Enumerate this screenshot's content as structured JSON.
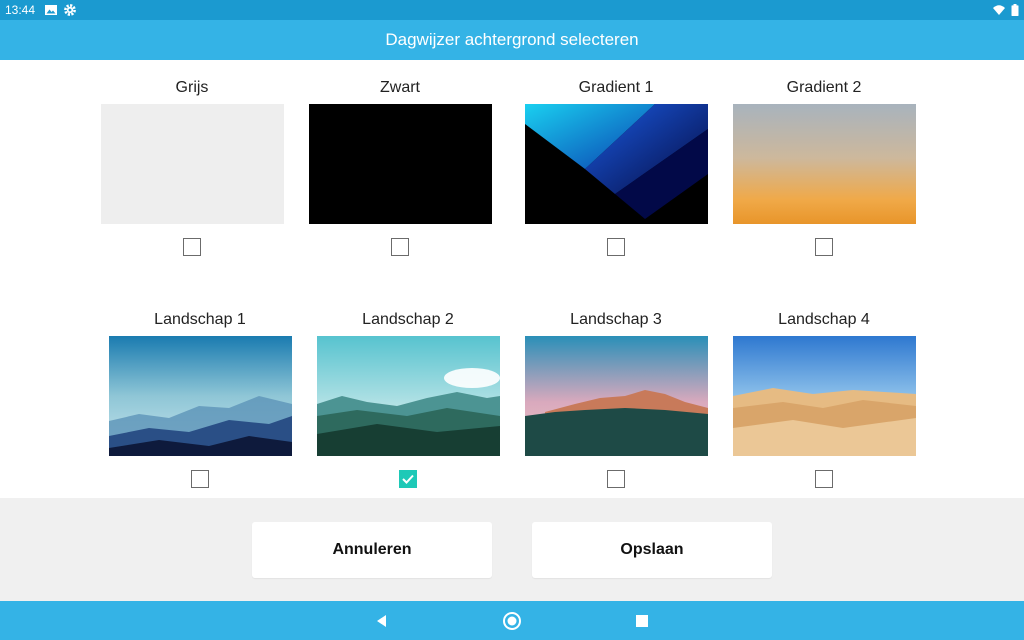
{
  "status_bar": {
    "time": "13:44",
    "left_icons": [
      "image-icon",
      "gear-icon"
    ],
    "right_icons": [
      "wifi-icon",
      "battery-icon"
    ]
  },
  "title": "Dagwijzer achtergrond selecteren",
  "options": [
    {
      "label": "Grijs",
      "checked": false,
      "thumbnail": "solid light gray"
    },
    {
      "label": "Zwart",
      "checked": false,
      "thumbnail": "solid black"
    },
    {
      "label": "Gradient 1",
      "checked": false,
      "thumbnail": "black with blue diagonal bands"
    },
    {
      "label": "Gradient 2",
      "checked": false,
      "thumbnail": "gray to orange vertical gradient"
    },
    {
      "label": "Landschap 1",
      "checked": false,
      "thumbnail": "misty blue mountains"
    },
    {
      "label": "Landschap 2",
      "checked": true,
      "thumbnail": "green hills under cyan sky"
    },
    {
      "label": "Landschap 3",
      "checked": false,
      "thumbnail": "pink sunset mountain ridge"
    },
    {
      "label": "Landschap 4",
      "checked": false,
      "thumbnail": "desert dunes under blue sky"
    }
  ],
  "buttons": {
    "cancel": "Annuleren",
    "save": "Opslaan"
  },
  "colors": {
    "status_bar": "#1b9ad0",
    "title_bar": "#34b3e6",
    "checked": "#1ec9b7",
    "footer": "#f0f0f0"
  },
  "nav_bar": {
    "icons": [
      "back-icon",
      "home-icon",
      "recents-icon"
    ]
  }
}
